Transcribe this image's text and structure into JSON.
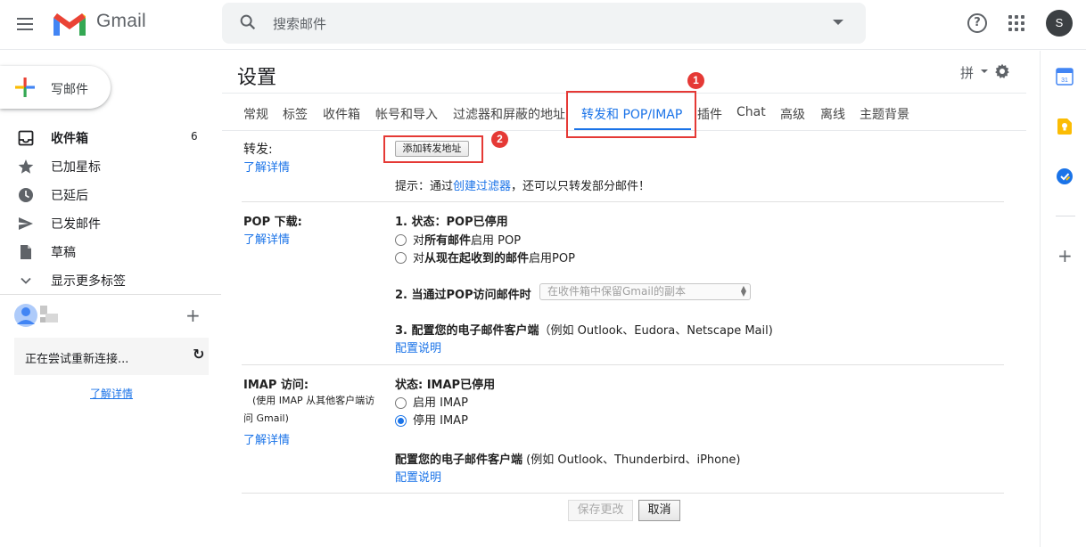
{
  "app": {
    "name": "Gmail"
  },
  "search": {
    "placeholder": "搜索邮件"
  },
  "header": {
    "help_glyph": "?",
    "avatar_letter": "S"
  },
  "sidebar": {
    "compose_label": "写邮件",
    "items": [
      {
        "label": "收件箱",
        "count": "6",
        "icon": "inbox-icon"
      },
      {
        "label": "已加星标",
        "icon": "star-icon"
      },
      {
        "label": "已延后",
        "icon": "clock-icon"
      },
      {
        "label": "已发邮件",
        "icon": "send-icon"
      },
      {
        "label": "草稿",
        "icon": "draft-icon"
      },
      {
        "label": "显示更多标签",
        "icon": "chevron-down-icon"
      }
    ],
    "chat_status": "正在尝试重新连接...",
    "chat_learn_more": "了解详情"
  },
  "settings": {
    "title": "设置",
    "input_method": "拼",
    "tabs": [
      "常规",
      "标签",
      "收件箱",
      "帐号和导入",
      "过滤器和屏蔽的地址",
      "转发和 POP/IMAP",
      "插件",
      "Chat",
      "高级",
      "离线",
      "主题背景"
    ],
    "active_tab": "转发和 POP/IMAP",
    "callouts": [
      "1",
      "2"
    ],
    "forwarding": {
      "label": "转发:",
      "learn_more": "了解详情",
      "add_button": "添加转发地址",
      "hint_prefix": "提示：通过",
      "hint_link": "创建过滤器",
      "hint_suffix": "，还可以只转发部分邮件！"
    },
    "pop": {
      "label": "POP 下载:",
      "learn_more": "了解详情",
      "status_prefix": "1. 状态：",
      "status_value": "POP已停用",
      "opt1_prefix": "对",
      "opt1_bold": "所有邮件",
      "opt1_suffix": "启用 POP",
      "opt2_prefix": "对",
      "opt2_bold": "从现在起收到的邮件",
      "opt2_suffix": "启用POP",
      "step2": "2. 当通过POP访问邮件时",
      "step2_select": "在收件箱中保留Gmail的副本",
      "step3_bold": "3. 配置您的电子邮件客户端",
      "step3_rest": "（例如 Outlook、Eudora、Netscape Mail)",
      "config_link": "配置说明"
    },
    "imap": {
      "label": "IMAP 访问:",
      "sub1": "(使用 IMAP 从其他客户端访",
      "sub2": "问 Gmail)",
      "learn_more": "了解详情",
      "status": "状态: IMAP已停用",
      "opt_enable": "启用 IMAP",
      "opt_disable": "停用 IMAP",
      "selected": "停用 IMAP",
      "config_bold": "配置您的电子邮件客户端",
      "config_rest": " (例如 Outlook、Thunderbird、iPhone)",
      "config_link": "配置说明"
    },
    "footer": {
      "save": "保存更改",
      "cancel": "取消"
    }
  },
  "colors": {
    "accent": "#1a73e8",
    "callout": "#e53935"
  }
}
